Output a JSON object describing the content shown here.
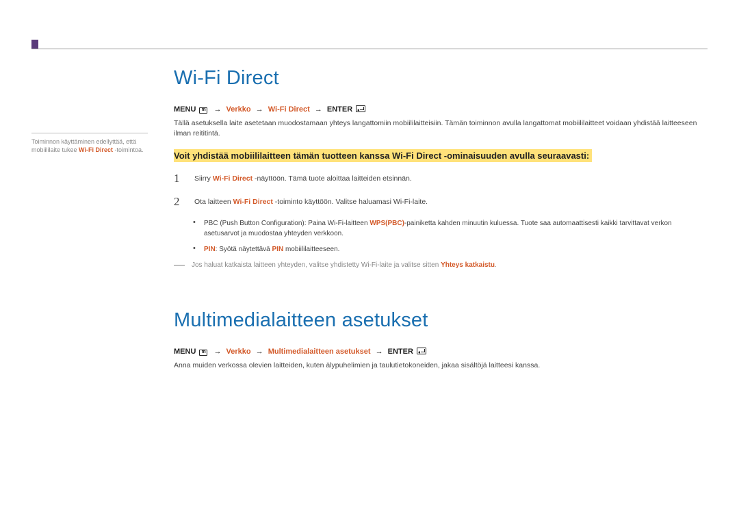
{
  "sidebar": {
    "line1": "Toiminnon käyttäminen edellyttää, että mobiililaite tukee ",
    "hl": "Wi-Fi Direct",
    "line2": " -toimintoa."
  },
  "section1": {
    "title": "Wi-Fi Direct",
    "breadcrumb": {
      "menu": "MENU",
      "arrow": "→",
      "item1": "Verkko",
      "item2": "Wi-Fi Direct",
      "enter": "ENTER"
    },
    "desc": "Tällä asetuksella laite asetetaan muodostamaan yhteys langattomiin mobiililaitteisiin. Tämän toiminnon avulla langattomat mobiililaitteet voidaan yhdistää laitteeseen ilman reititintä.",
    "highlight": "Voit yhdistää mobiililaitteen tämän tuotteen kanssa Wi-Fi Direct -ominaisuuden avulla seuraavasti:",
    "step1": {
      "num": "1",
      "pre": "Siirry ",
      "hl": "Wi-Fi Direct",
      "post": " -näyttöön. Tämä tuote aloittaa laitteiden etsinnän."
    },
    "step2": {
      "num": "2",
      "pre": "Ota laitteen ",
      "hl": "Wi-Fi Direct",
      "post": " -toiminto käyttöön. Valitse haluamasi Wi-Fi-laite."
    },
    "bullet1": {
      "pre": "PBC (Push Button Configuration): Paina Wi-Fi-laitteen ",
      "hl": "WPS(PBC)",
      "post": "-painiketta kahden minuutin kuluessa. Tuote saa automaattisesti kaikki tarvittavat verkon asetusarvot ja muodostaa yhteyden verkkoon."
    },
    "bullet2": {
      "hl1": "PIN",
      "mid": ": Syötä näytettävä ",
      "hl2": "PIN",
      "post": " mobiililaitteeseen."
    },
    "note": {
      "pre": "Jos haluat katkaista laitteen yhteyden, valitse yhdistetty Wi-Fi-laite ja valitse sitten ",
      "hl": "Yhteys katkaistu",
      "post": "."
    }
  },
  "section2": {
    "title": "Multimedialaitteen asetukset",
    "breadcrumb": {
      "menu": "MENU",
      "arrow": "→",
      "item1": "Verkko",
      "item2": "Multimedialaitteen asetukset",
      "enter": "ENTER"
    },
    "desc": "Anna muiden verkossa olevien laitteiden, kuten älypuhelimien ja taulutietokoneiden, jakaa sisältöjä laitteesi kanssa."
  },
  "iconM": "m"
}
